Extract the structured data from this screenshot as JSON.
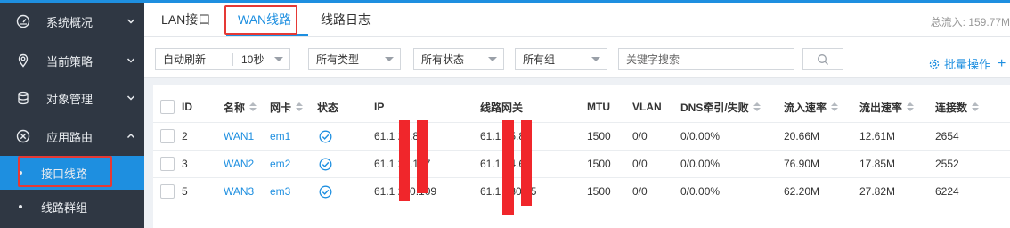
{
  "sidebar": {
    "items": [
      {
        "label": "系统概况",
        "icon": "dashboard-icon"
      },
      {
        "label": "当前策略",
        "icon": "location-pin-icon"
      },
      {
        "label": "对象管理",
        "icon": "database-icon"
      },
      {
        "label": "应用路由",
        "icon": "cross-circle-icon"
      }
    ],
    "sub_items": [
      {
        "label": "接口线路",
        "active": true
      },
      {
        "label": "线路群组",
        "active": false
      }
    ]
  },
  "tabs": [
    {
      "label": "LAN接口",
      "active": false
    },
    {
      "label": "WAN线路",
      "active": true
    },
    {
      "label": "线路日志",
      "active": false
    }
  ],
  "total_flow": "总流入: 159.77M",
  "toolbar": {
    "auto_refresh": "自动刷新",
    "interval": "10秒",
    "type_select": "所有类型",
    "status_select": "所有状态",
    "group_select": "所有组",
    "search_placeholder": "关键字搜索",
    "batch_label": "批量操作",
    "add_label": "+"
  },
  "table": {
    "headers": [
      "ID",
      "名称",
      "网卡",
      "状态",
      "IP",
      "线路网关",
      "MTU",
      "VLAN",
      "DNS牵引/失败",
      "流入速率",
      "流出速率",
      "连接数"
    ],
    "rows": [
      {
        "id": "2",
        "name": "WAN1",
        "nic": "em1",
        "ip": "61.1  2.  .83",
        "gateway": "61.1   .  5.81",
        "mtu": "1500",
        "vlan": "0/0",
        "dns": "0/0.00%",
        "in": "20.66M",
        "out": "12.61M",
        "conn": "2654"
      },
      {
        "id": "3",
        "name": "WAN2",
        "nic": "em2",
        "ip": "61.1  2.  .107",
        "gateway": "61.1   .  4.65",
        "mtu": "1500",
        "vlan": "0/0",
        "dns": "0/0.00%",
        "in": "76.90M",
        "out": "17.85M",
        "conn": "2552"
      },
      {
        "id": "5",
        "name": "WAN3",
        "nic": "em3",
        "ip": "61.1  2.  0.109",
        "gateway": "61.1   .  30.65",
        "mtu": "1500",
        "vlan": "0/0",
        "dns": "0/0.00%",
        "in": "62.20M",
        "out": "27.82M",
        "conn": "6224"
      }
    ]
  },
  "colors": {
    "accent": "#1e8fe0",
    "sidebar": "#2f3743",
    "highlight_box": "#e53935",
    "redaction": "#f0262b"
  }
}
